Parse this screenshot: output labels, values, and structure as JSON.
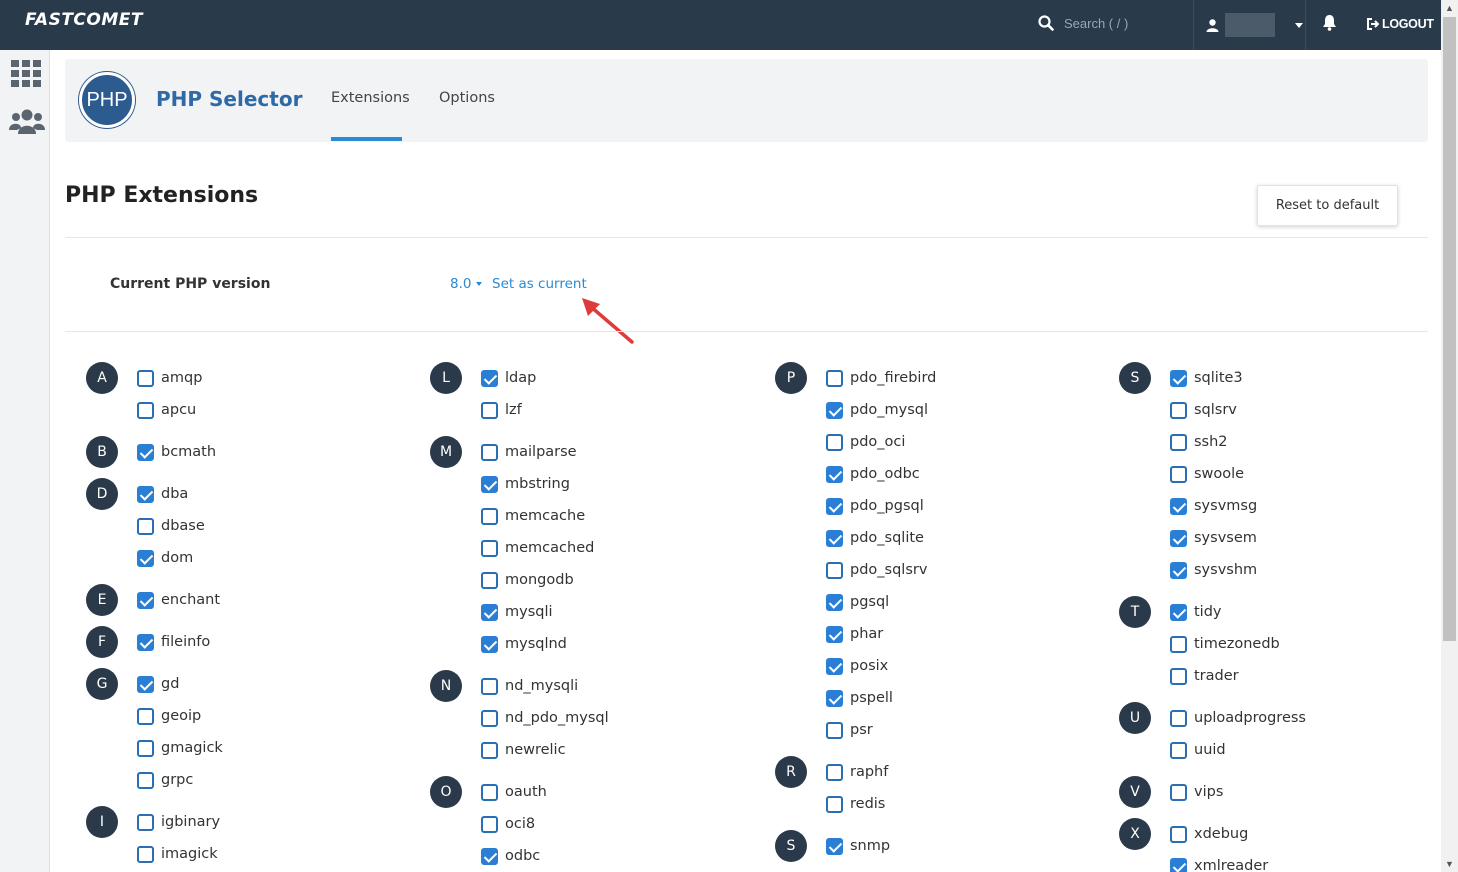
{
  "topbar": {
    "logo": "FASTCOMET",
    "search_placeholder": "Search ( / )",
    "username": "user",
    "logout_label": "LOGOUT"
  },
  "header": {
    "app_title": "PHP Selector",
    "logo_text": "PHP",
    "tabs": [
      {
        "label": "Extensions",
        "active": true
      },
      {
        "label": "Options",
        "active": false
      }
    ]
  },
  "section": {
    "title": "PHP Extensions",
    "reset_label": "Reset to default"
  },
  "version": {
    "label": "Current PHP version",
    "value": "8.0",
    "set_current_label": "Set as current"
  },
  "colors": {
    "topbar": "#293a4a",
    "accent": "#2a8ad3",
    "checkbox_checked": "#2a7fd4",
    "letter_badge": "#2b3a4a",
    "annotation_arrow": "#e03b3b"
  },
  "columns": [
    {
      "groups": [
        {
          "letter": "A",
          "items": [
            {
              "name": "amqp",
              "checked": false
            },
            {
              "name": "apcu",
              "checked": false
            }
          ]
        },
        {
          "letter": "B",
          "items": [
            {
              "name": "bcmath",
              "checked": true
            }
          ]
        },
        {
          "letter": "D",
          "items": [
            {
              "name": "dba",
              "checked": true
            },
            {
              "name": "dbase",
              "checked": false
            },
            {
              "name": "dom",
              "checked": true
            }
          ]
        },
        {
          "letter": "E",
          "items": [
            {
              "name": "enchant",
              "checked": true
            }
          ]
        },
        {
          "letter": "F",
          "items": [
            {
              "name": "fileinfo",
              "checked": true
            }
          ]
        },
        {
          "letter": "G",
          "items": [
            {
              "name": "gd",
              "checked": true
            },
            {
              "name": "geoip",
              "checked": false
            },
            {
              "name": "gmagick",
              "checked": false
            },
            {
              "name": "grpc",
              "checked": false
            }
          ]
        },
        {
          "letter": "I",
          "items": [
            {
              "name": "igbinary",
              "checked": false
            },
            {
              "name": "imagick",
              "checked": false
            }
          ]
        }
      ]
    },
    {
      "groups": [
        {
          "letter": "L",
          "items": [
            {
              "name": "ldap",
              "checked": true
            },
            {
              "name": "lzf",
              "checked": false
            }
          ]
        },
        {
          "letter": "M",
          "items": [
            {
              "name": "mailparse",
              "checked": false
            },
            {
              "name": "mbstring",
              "checked": true
            },
            {
              "name": "memcache",
              "checked": false
            },
            {
              "name": "memcached",
              "checked": false
            },
            {
              "name": "mongodb",
              "checked": false
            },
            {
              "name": "mysqli",
              "checked": true
            },
            {
              "name": "mysqlnd",
              "checked": true
            }
          ]
        },
        {
          "letter": "N",
          "items": [
            {
              "name": "nd_mysqli",
              "checked": false
            },
            {
              "name": "nd_pdo_mysql",
              "checked": false
            },
            {
              "name": "newrelic",
              "checked": false
            }
          ]
        },
        {
          "letter": "O",
          "items": [
            {
              "name": "oauth",
              "checked": false
            },
            {
              "name": "oci8",
              "checked": false
            },
            {
              "name": "odbc",
              "checked": true
            }
          ]
        }
      ]
    },
    {
      "groups": [
        {
          "letter": "P",
          "items": [
            {
              "name": "pdo_firebird",
              "checked": false
            },
            {
              "name": "pdo_mysql",
              "checked": true
            },
            {
              "name": "pdo_oci",
              "checked": false
            },
            {
              "name": "pdo_odbc",
              "checked": true
            },
            {
              "name": "pdo_pgsql",
              "checked": true
            },
            {
              "name": "pdo_sqlite",
              "checked": true
            },
            {
              "name": "pdo_sqlsrv",
              "checked": false
            },
            {
              "name": "pgsql",
              "checked": true
            },
            {
              "name": "phar",
              "checked": true
            },
            {
              "name": "posix",
              "checked": true
            },
            {
              "name": "pspell",
              "checked": true
            },
            {
              "name": "psr",
              "checked": false
            }
          ]
        },
        {
          "letter": "R",
          "items": [
            {
              "name": "raphf",
              "checked": false
            },
            {
              "name": "redis",
              "checked": false
            }
          ]
        },
        {
          "letter": "S",
          "items": [
            {
              "name": "snmp",
              "checked": true
            }
          ]
        }
      ]
    },
    {
      "groups": [
        {
          "letter": "S",
          "items": [
            {
              "name": "sqlite3",
              "checked": true
            },
            {
              "name": "sqlsrv",
              "checked": false
            },
            {
              "name": "ssh2",
              "checked": false
            },
            {
              "name": "swoole",
              "checked": false
            },
            {
              "name": "sysvmsg",
              "checked": true
            },
            {
              "name": "sysvsem",
              "checked": true
            },
            {
              "name": "sysvshm",
              "checked": true
            }
          ]
        },
        {
          "letter": "T",
          "items": [
            {
              "name": "tidy",
              "checked": true
            },
            {
              "name": "timezonedb",
              "checked": false
            },
            {
              "name": "trader",
              "checked": false
            }
          ]
        },
        {
          "letter": "U",
          "items": [
            {
              "name": "uploadprogress",
              "checked": false
            },
            {
              "name": "uuid",
              "checked": false
            }
          ]
        },
        {
          "letter": "V",
          "items": [
            {
              "name": "vips",
              "checked": false
            }
          ]
        },
        {
          "letter": "X",
          "items": [
            {
              "name": "xdebug",
              "checked": false
            },
            {
              "name": "xmlreader",
              "checked": true
            }
          ]
        }
      ]
    }
  ]
}
